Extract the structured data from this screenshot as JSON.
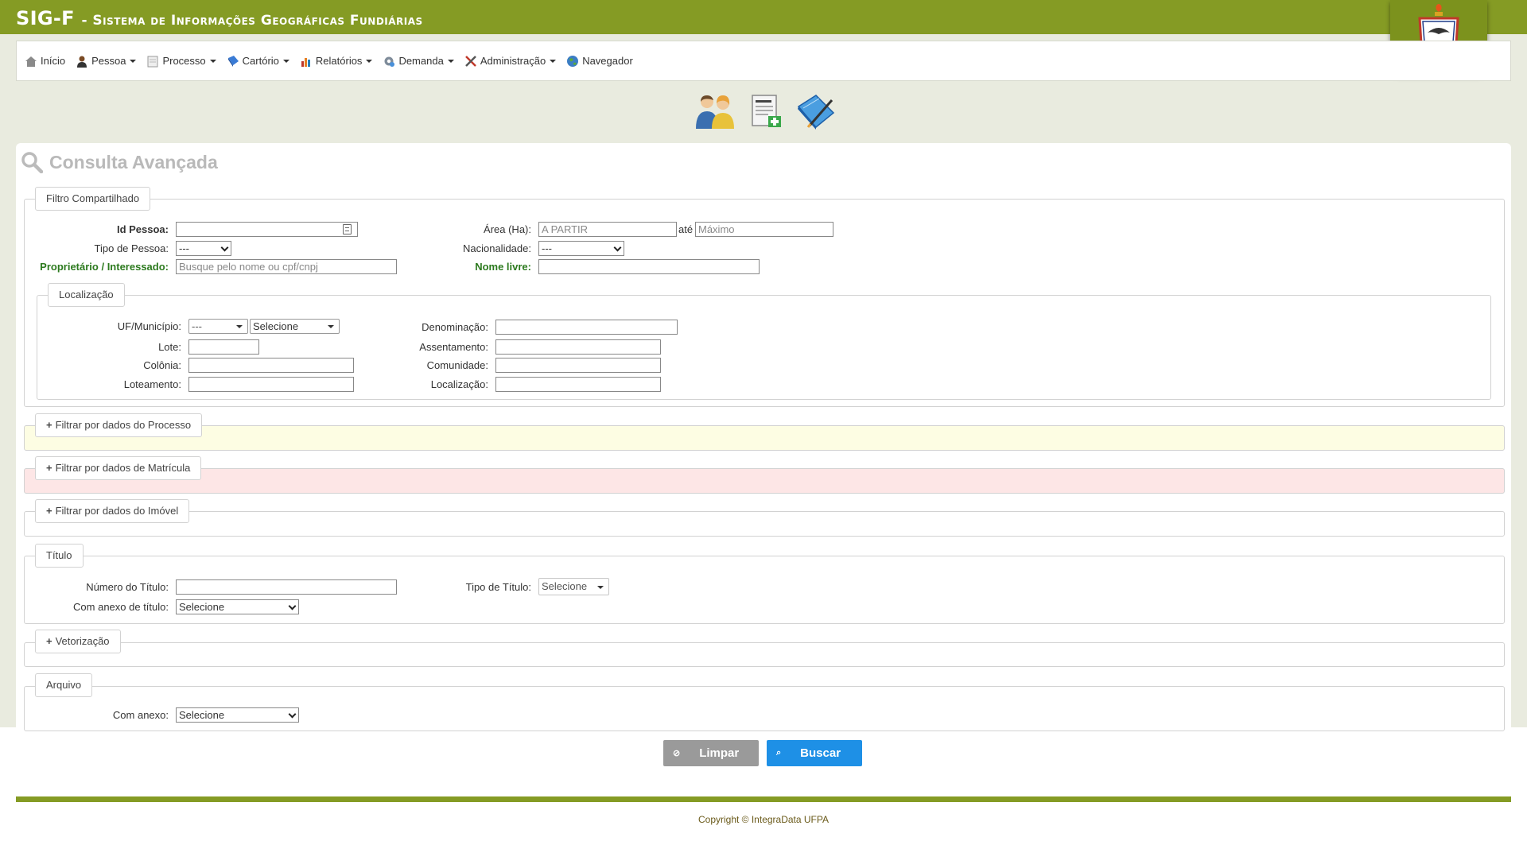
{
  "header": {
    "title_main": "SIG-F",
    "title_sub": "- Sistema de Informações Geográficas Fundiárias"
  },
  "menu": [
    {
      "label": "Início",
      "icon": "home-icon",
      "dropdown": false
    },
    {
      "label": "Pessoa",
      "icon": "person-icon",
      "dropdown": true
    },
    {
      "label": "Processo",
      "icon": "document-icon",
      "dropdown": true
    },
    {
      "label": "Cartório",
      "icon": "book-icon",
      "dropdown": true
    },
    {
      "label": "Relatórios",
      "icon": "bar-chart-icon",
      "dropdown": true
    },
    {
      "label": "Demanda",
      "icon": "gear-icon",
      "dropdown": true
    },
    {
      "label": "Administração",
      "icon": "tools-icon",
      "dropdown": true
    },
    {
      "label": "Navegador",
      "icon": "globe-icon",
      "dropdown": false
    }
  ],
  "page": {
    "title": "Consulta Avançada"
  },
  "filtro": {
    "legend": "Filtro Compartilhado",
    "id_pessoa_label": "Id Pessoa:",
    "tipo_pessoa_label": "Tipo de Pessoa:",
    "tipo_pessoa_value": "---",
    "proprietario_label": "Proprietário / Interessado:",
    "proprietario_placeholder": "Busque pelo nome ou cpf/cnpj",
    "area_label": "Área (Ha):",
    "area_min_placeholder": "A PARTIR",
    "ate_label": "até",
    "area_max_placeholder": "Máximo",
    "nacionalidade_label": "Nacionalidade:",
    "nacionalidade_value": "---",
    "nome_livre_label": "Nome livre:"
  },
  "localizacao": {
    "legend": "Localização",
    "uf_label": "UF/Município:",
    "uf_value": "---",
    "municipio_value": "Selecione",
    "lote_label": "Lote:",
    "colonia_label": "Colônia:",
    "loteamento_label": "Loteamento:",
    "denominacao_label": "Denominação:",
    "assentamento_label": "Assentamento:",
    "comunidade_label": "Comunidade:",
    "localizacao_label": "Localização:"
  },
  "collapsibles": {
    "processo": "Filtrar por dados do Processo",
    "matricula": "Filtrar por dados de Matrícula",
    "imovel": "Filtrar por dados do Imóvel",
    "vetorizacao": "Vetorização"
  },
  "titulo": {
    "legend": "Título",
    "numero_label": "Número do Título:",
    "anexo_label": "Com anexo de título:",
    "anexo_value": "Selecione",
    "tipo_label": "Tipo de Título:",
    "tipo_value": "Selecione"
  },
  "arquivo": {
    "legend": "Arquivo",
    "anexo_label": "Com anexo:",
    "anexo_value": "Selecione"
  },
  "actions": {
    "limpar": "Limpar",
    "buscar": "Buscar"
  },
  "colors": {
    "brand": "#859b24",
    "limpar_bg": "#9a9a9a",
    "buscar_bg": "#1e90e6",
    "green_label": "#2c7a1e"
  },
  "footer": {
    "copyright": "Copyright © IntegraData UFPA"
  }
}
